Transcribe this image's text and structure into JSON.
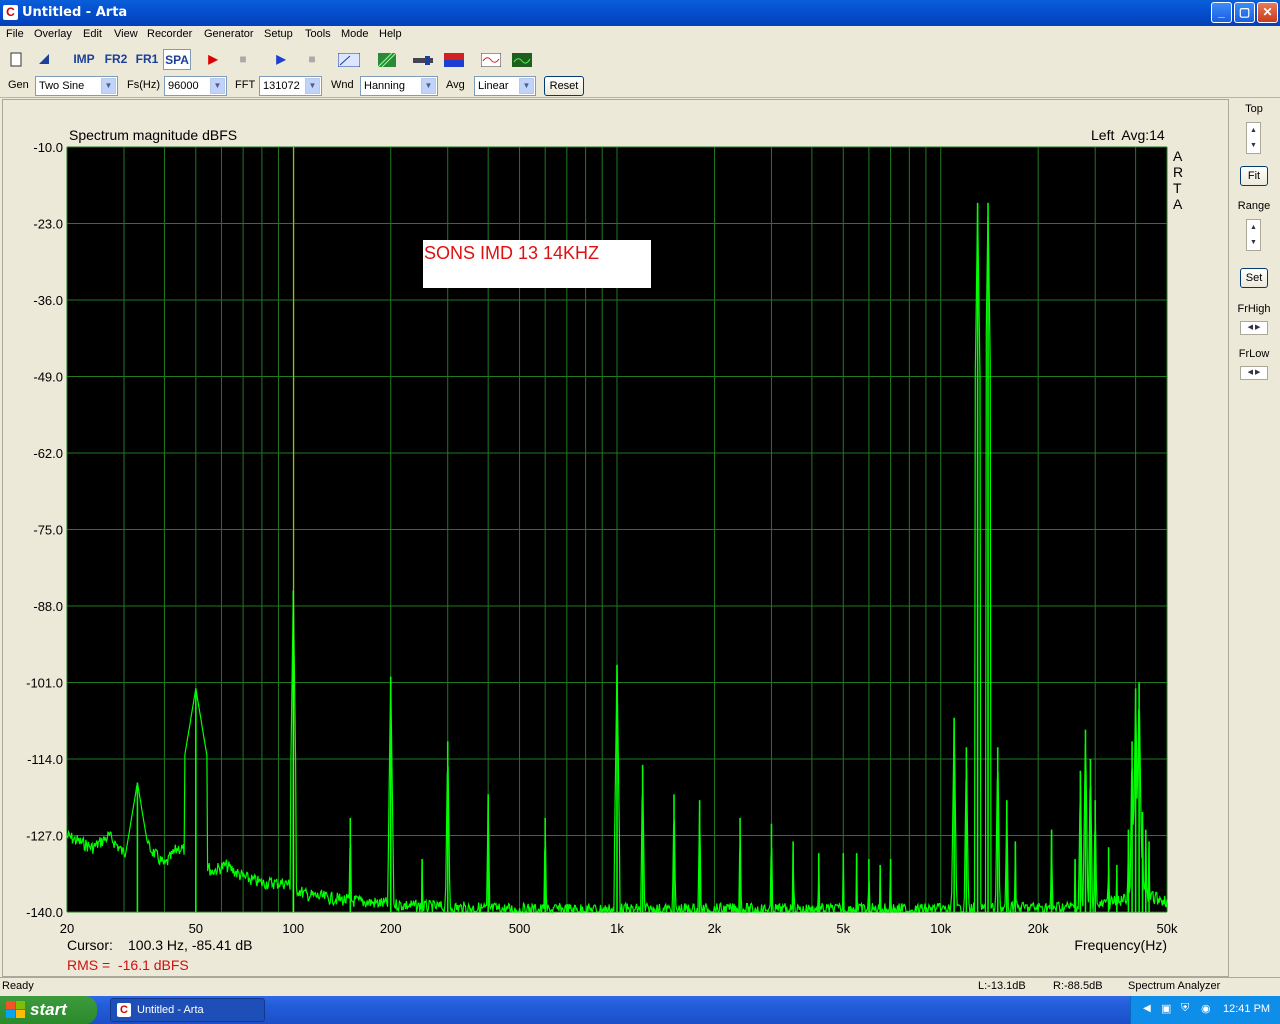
{
  "window": {
    "title": "Untitled - Arta",
    "app_icon": "arta-logo-icon"
  },
  "menu": [
    "File",
    "Overlay",
    "Edit",
    "View",
    "Recorder",
    "Generator",
    "Setup",
    "Tools",
    "Mode",
    "Help"
  ],
  "toolbar": {
    "imp": "IMP",
    "fr2": "FR2",
    "fr1": "FR1",
    "spa": "SPA"
  },
  "options": {
    "gen_label": "Gen",
    "gen_value": "Two Sine",
    "fs_label": "Fs(Hz)",
    "fs_value": "96000",
    "fft_label": "FFT",
    "fft_value": "131072",
    "wnd_label": "Wnd",
    "wnd_value": "Hanning",
    "avg_label": "Avg",
    "avg_value": "Linear",
    "reset_label": "Reset"
  },
  "side": {
    "top_label": "Top",
    "fit_label": "Fit",
    "range_label": "Range",
    "set_label": "Set",
    "frhigh_label": "FrHigh",
    "frlow_label": "FrLow"
  },
  "plot": {
    "title": "Spectrum magnitude dBFS",
    "channel": "Left  Avg:14",
    "brand": [
      "A",
      "R",
      "T",
      "A"
    ],
    "annotation": "SONS IMD 13 14KHZ",
    "cursor_label": "Cursor:",
    "cursor_value": "100.3 Hz, -85.41 dB",
    "rms_text": "RMS =  -16.1 dBFS",
    "xaxis_label": "Frequency(Hz)"
  },
  "chart_data": {
    "type": "line",
    "x_scale": "log",
    "xlim": [
      20,
      50000
    ],
    "ylim": [
      -140,
      -10
    ],
    "yticks": [
      "-10.0",
      "-23.0",
      "-36.0",
      "-49.0",
      "-62.0",
      "-75.0",
      "-88.0",
      "-101.0",
      "-114.0",
      "-127.0",
      "-140.0"
    ],
    "xticks": [
      {
        "v": 20,
        "l": "20"
      },
      {
        "v": 50,
        "l": "50"
      },
      {
        "v": 100,
        "l": "100"
      },
      {
        "v": 200,
        "l": "200"
      },
      {
        "v": 500,
        "l": "500"
      },
      {
        "v": 1000,
        "l": "1k"
      },
      {
        "v": 2000,
        "l": "2k"
      },
      {
        "v": 5000,
        "l": "5k"
      },
      {
        "v": 10000,
        "l": "10k"
      },
      {
        "v": 20000,
        "l": "20k"
      },
      {
        "v": 50000,
        "l": "50k"
      }
    ],
    "grid": true,
    "cursor_hz": 100.3,
    "noise_floor": [
      [
        20,
        -126
      ],
      [
        24,
        -128
      ],
      [
        27,
        -126
      ],
      [
        30,
        -129
      ],
      [
        33,
        -126
      ],
      [
        36,
        -128
      ],
      [
        40,
        -131
      ],
      [
        44,
        -128
      ],
      [
        50,
        -129
      ],
      [
        56,
        -132
      ],
      [
        62,
        -131
      ],
      [
        70,
        -133
      ],
      [
        80,
        -134
      ],
      [
        95,
        -134
      ],
      [
        110,
        -136
      ],
      [
        150,
        -137
      ],
      [
        250,
        -138
      ],
      [
        500,
        -138.5
      ],
      [
        2000,
        -138.5
      ],
      [
        10000,
        -138.5
      ],
      [
        30000,
        -138
      ],
      [
        42000,
        -136
      ],
      [
        50000,
        -137
      ]
    ],
    "peaks": [
      [
        33,
        -118
      ],
      [
        50,
        -102
      ],
      [
        100,
        -85.4
      ],
      [
        150,
        -124
      ],
      [
        200,
        -100
      ],
      [
        250,
        -131
      ],
      [
        300,
        -111
      ],
      [
        400,
        -120
      ],
      [
        600,
        -124
      ],
      [
        1000,
        -98
      ],
      [
        1200,
        -115
      ],
      [
        1500,
        -120
      ],
      [
        1800,
        -121
      ],
      [
        2400,
        -124
      ],
      [
        3000,
        -125
      ],
      [
        3500,
        -128
      ],
      [
        4200,
        -130
      ],
      [
        5000,
        -130
      ],
      [
        5500,
        -130
      ],
      [
        6000,
        -131
      ],
      [
        6500,
        -132
      ],
      [
        7000,
        -131
      ],
      [
        11000,
        -107
      ],
      [
        12000,
        -112
      ],
      [
        13000,
        -19.5
      ],
      [
        14000,
        -19.5
      ],
      [
        15000,
        -112
      ],
      [
        16000,
        -121
      ],
      [
        17000,
        -128
      ],
      [
        22000,
        -126
      ],
      [
        26000,
        -131
      ],
      [
        27000,
        -116
      ],
      [
        28000,
        -109
      ],
      [
        29000,
        -114
      ],
      [
        30000,
        -121
      ],
      [
        33000,
        -129
      ],
      [
        35000,
        -132
      ],
      [
        38000,
        -126
      ],
      [
        39000,
        -111
      ],
      [
        40000,
        -102
      ],
      [
        41000,
        -101
      ],
      [
        42000,
        -123
      ],
      [
        43000,
        -126
      ],
      [
        44000,
        -128
      ]
    ],
    "line_color": "#00ff00",
    "background": "#000000",
    "grid_color": "#207a20"
  },
  "status": {
    "ready": "Ready",
    "left_level": "L:-13.1dB",
    "right_level": "R:-88.5dB",
    "mode": "Spectrum Analyzer"
  },
  "taskbar": {
    "start": "start",
    "task": "Untitled - Arta",
    "clock": "12:41 PM"
  }
}
